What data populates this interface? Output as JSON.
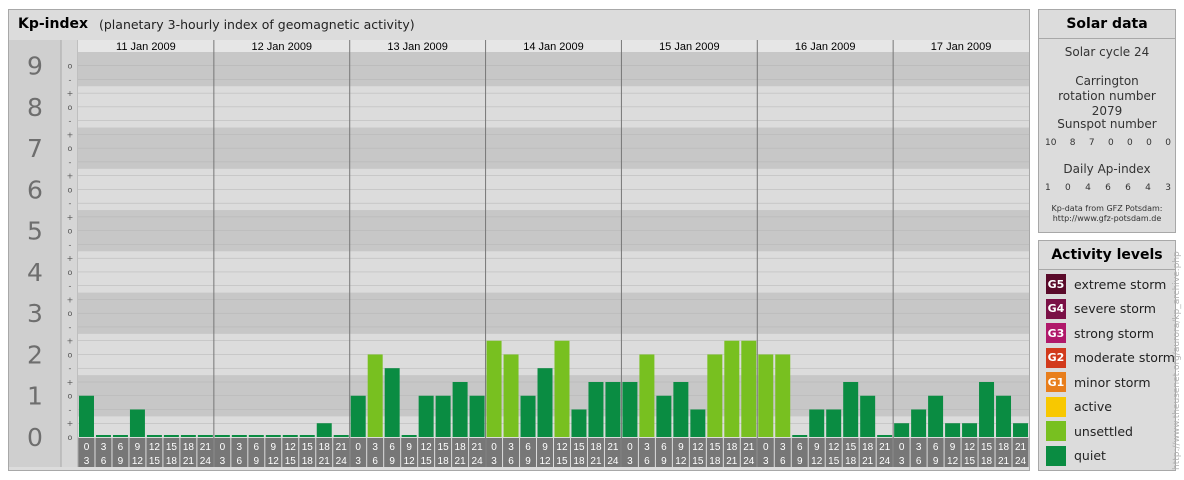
{
  "header": {
    "title": "Kp-index",
    "subtitle": "(planetary 3-hourly index of geomagnetic activity)"
  },
  "chart_data": {
    "type": "bar",
    "title": "Kp-index",
    "subtitle": "(planetary 3-hourly index of geomagnetic activity)",
    "y_major_labels": [
      "0",
      "1",
      "2",
      "3",
      "4",
      "5",
      "6",
      "7",
      "8",
      "9"
    ],
    "y_minor_labels": [
      "+",
      "-",
      "o"
    ],
    "ylim": [
      0,
      9.33
    ],
    "days": [
      "11 Jan 2009",
      "12 Jan 2009",
      "13 Jan 2009",
      "14 Jan 2009",
      "15 Jan 2009",
      "16 Jan 2009",
      "17 Jan 2009"
    ],
    "interval_start_labels": [
      "0",
      "3",
      "6",
      "9",
      "12",
      "15",
      "18",
      "21"
    ],
    "interval_end_labels": [
      "3",
      "6",
      "9",
      "12",
      "15",
      "18",
      "21",
      "24"
    ],
    "values": [
      [
        1.0,
        0.0,
        0.0,
        0.667,
        0.0,
        0.0,
        0.0,
        0.0
      ],
      [
        0.0,
        0.0,
        0.0,
        0.0,
        0.0,
        0.0,
        0.333,
        0.0
      ],
      [
        1.0,
        2.0,
        1.667,
        0.0,
        1.0,
        1.0,
        1.333,
        1.0
      ],
      [
        2.333,
        2.0,
        1.0,
        1.667,
        2.333,
        0.667,
        1.333,
        1.333
      ],
      [
        1.333,
        2.0,
        1.0,
        1.333,
        0.667,
        2.0,
        2.333,
        2.333
      ],
      [
        2.0,
        2.0,
        0.0,
        0.667,
        0.667,
        1.333,
        1.0,
        0.0
      ],
      [
        0.333,
        0.667,
        1.0,
        0.333,
        0.333,
        1.333,
        1.0,
        0.333
      ]
    ],
    "grid": true
  },
  "levels": [
    {
      "key": "G5",
      "label": "extreme storm",
      "color": "#5a0a2a"
    },
    {
      "key": "G4",
      "label": "severe storm",
      "color": "#7a1046"
    },
    {
      "key": "G3",
      "label": "strong storm",
      "color": "#b0186a"
    },
    {
      "key": "G2",
      "label": "moderate storm",
      "color": "#d23a1c"
    },
    {
      "key": "G1",
      "label": "minor storm",
      "color": "#e87e1c"
    },
    {
      "key": "",
      "label": "active",
      "color": "#f8c800"
    },
    {
      "key": "",
      "label": "unsettled",
      "color": "#78c020"
    },
    {
      "key": "",
      "label": "quiet",
      "color": "#0a8c42"
    }
  ],
  "solar": {
    "title": "Solar data",
    "cycle": "Solar cycle 24",
    "carrington": "Carrington rotation number 2079",
    "sunspot_label": "Sunspot number",
    "sunspot_values": [
      "10",
      "8",
      "7",
      "0",
      "0",
      "0",
      "0"
    ],
    "ap_label": "Daily Ap-index",
    "ap_values": [
      "1",
      "0",
      "4",
      "6",
      "6",
      "4",
      "3"
    ],
    "source": "Kp-data from GFZ Potsdam:",
    "source_url": "http://www.gfz-potsdam.de"
  },
  "activity": {
    "title": "Activity levels"
  },
  "watermark": "http://www.theusenet.org/aurora/kp_archive.php"
}
